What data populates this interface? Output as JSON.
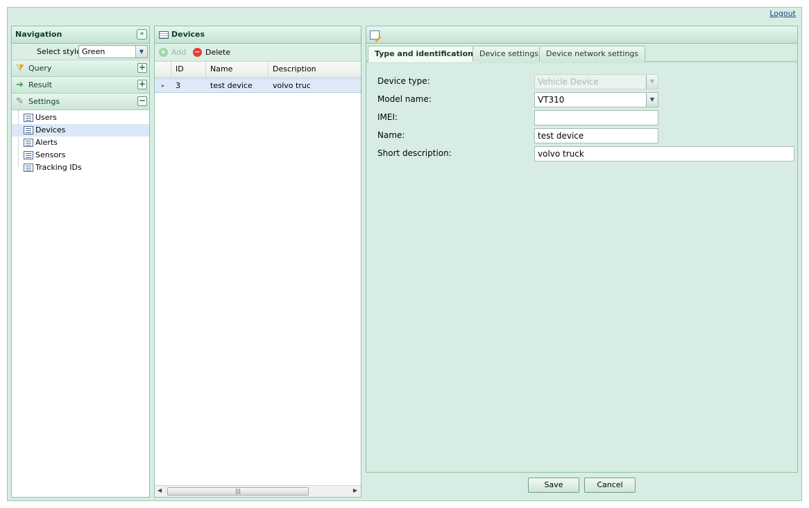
{
  "header": {
    "logout_label": "Logout"
  },
  "navigation": {
    "title": "Navigation",
    "style_label": "Select style",
    "style_value": "Green",
    "sections": [
      {
        "label": "Query",
        "toggle": "+"
      },
      {
        "label": "Result",
        "toggle": "+"
      },
      {
        "label": "Settings",
        "toggle": "−"
      }
    ],
    "settings_items": [
      {
        "label": "Users"
      },
      {
        "label": "Devices"
      },
      {
        "label": "Alerts"
      },
      {
        "label": "Sensors"
      },
      {
        "label": "Tracking IDs"
      }
    ]
  },
  "devices": {
    "title": "Devices",
    "add_label": "Add",
    "delete_label": "Delete",
    "columns": [
      "ID",
      "Name",
      "Description"
    ],
    "rows": [
      {
        "id": "3",
        "name": "test device",
        "description": "volvo truck"
      }
    ]
  },
  "detail": {
    "tabs": [
      "Type and identification",
      "Device settings",
      "Device network settings"
    ],
    "fields": {
      "device_type": {
        "label": "Device type:",
        "value": "Vehicle Device"
      },
      "model_name": {
        "label": "Model name:",
        "value": "VT310"
      },
      "imei": {
        "label": "IMEI:",
        "value": ""
      },
      "name": {
        "label": "Name:",
        "value": "test device"
      },
      "short_description": {
        "label": "Short description:",
        "value": "volvo truck"
      }
    },
    "save_label": "Save",
    "cancel_label": "Cancel"
  },
  "colors": {
    "app_background": "#d7ede3",
    "header_gradient_top": "#e6f5ed",
    "selected_row": "#dce9f8",
    "delete_icon": "#e2403a",
    "add_icon_disabled": "#9ed7a8"
  }
}
